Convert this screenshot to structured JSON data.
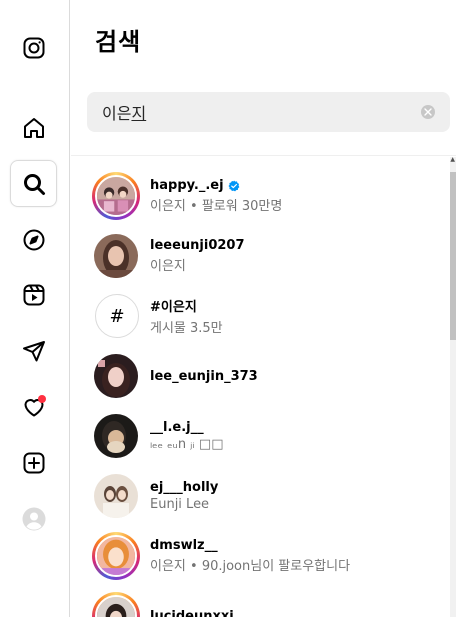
{
  "panel": {
    "title": "검색",
    "search_value_prefix": "이은",
    "search_value_composing": "지"
  },
  "sidebar": {
    "items": [
      {
        "name": "instagram-logo-icon"
      },
      {
        "name": "home-icon"
      },
      {
        "name": "search-icon",
        "active": true
      },
      {
        "name": "explore-icon"
      },
      {
        "name": "reels-icon"
      },
      {
        "name": "messages-icon"
      },
      {
        "name": "notifications-icon",
        "has_badge": true
      },
      {
        "name": "create-icon"
      },
      {
        "name": "profile-icon"
      }
    ]
  },
  "results": [
    {
      "username": "happy._.ej",
      "verified": true,
      "subtitle": "이은지 • 팔로워 30만명",
      "story": true
    },
    {
      "username": "leeeunji0207",
      "verified": false,
      "subtitle": "이은지",
      "story": false
    },
    {
      "username": "#이은지",
      "verified": false,
      "subtitle": "게시물 3.5만",
      "hashtag": true
    },
    {
      "username": "lee_eunjin_373",
      "verified": false,
      "subtitle": "",
      "story": false
    },
    {
      "username": "__l.e.j__",
      "verified": false,
      "subtitle": "ₗₑₑ ₑᵤn ⱼᵢ □□",
      "story": false
    },
    {
      "username": "ej___holly",
      "verified": false,
      "subtitle": "Eunji Lee",
      "story": false
    },
    {
      "username": "dmswlz__",
      "verified": false,
      "subtitle": "이은지 • 90.joon님이 팔로우합니다",
      "story": true
    },
    {
      "username": "lucideunxxi_",
      "verified": false,
      "subtitle": "",
      "story": true
    }
  ]
}
